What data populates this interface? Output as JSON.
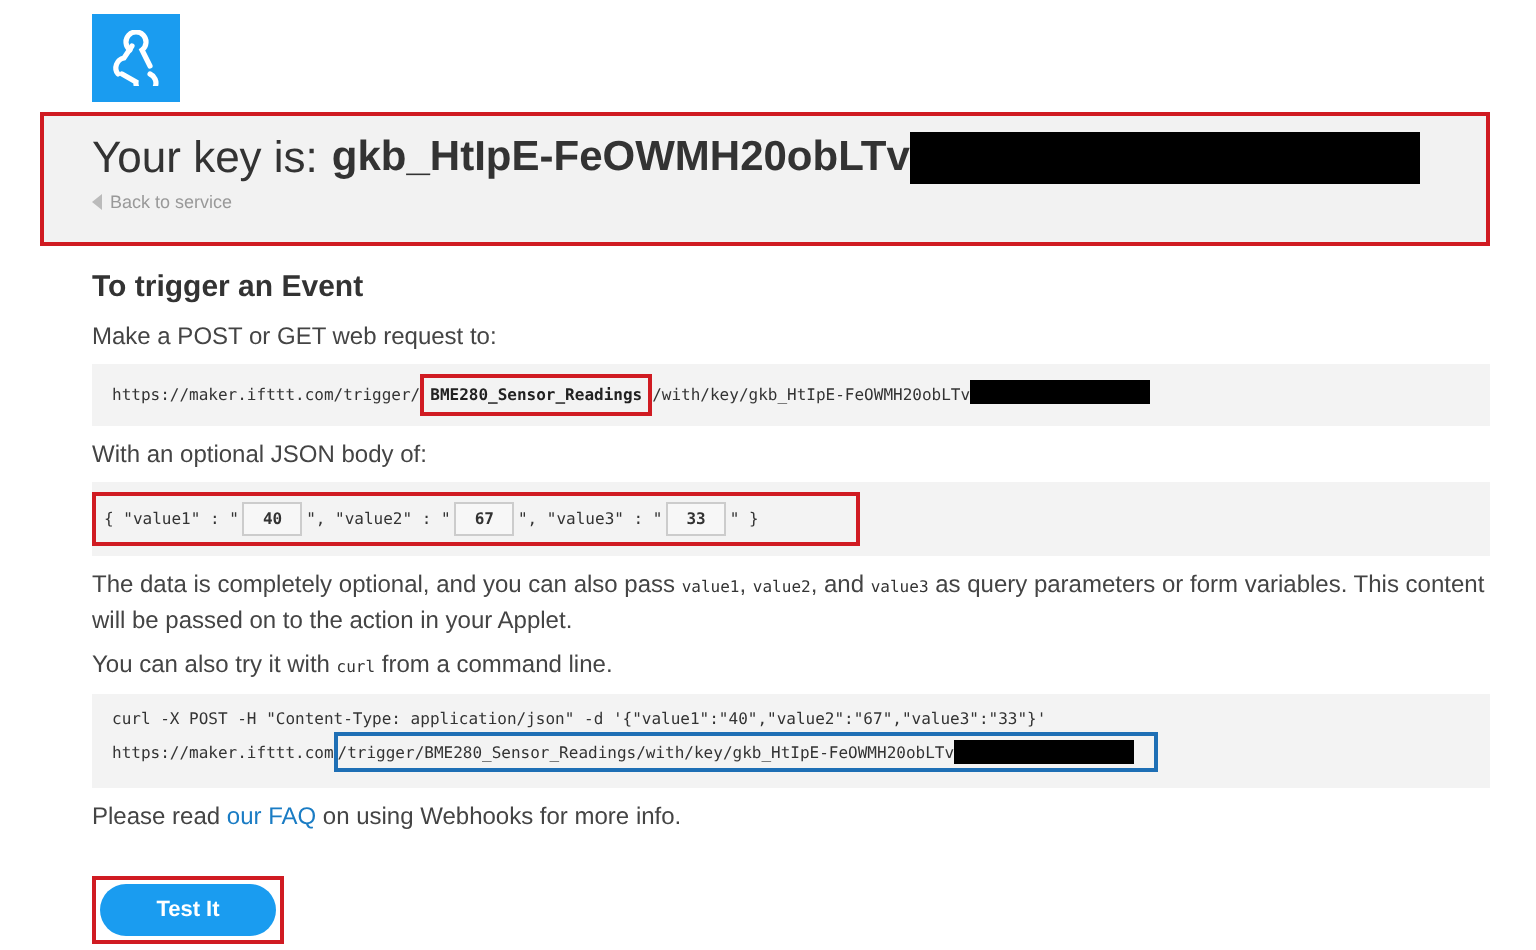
{
  "key_panel": {
    "label": "Your key is:",
    "key": "gkb_HtIpE-FeOWMH20obLTv",
    "back_link": "Back to service"
  },
  "heading": "To trigger an Event",
  "request_intro": "Make a POST or GET web request to:",
  "request_url": {
    "prefix": "https://maker.ifttt.com/trigger/",
    "event": "BME280_Sensor_Readings",
    "suffix": "/with/key/gkb_HtIpE-FeOWMH20obLTv"
  },
  "body_intro": "With an optional JSON body of:",
  "json_body": [
    {
      "kind": "code",
      "text": "{ \"value1\" : \""
    },
    {
      "kind": "input",
      "text": "40"
    },
    {
      "kind": "code",
      "text": "\", \"value2\" : \""
    },
    {
      "kind": "input",
      "text": "67"
    },
    {
      "kind": "code",
      "text": "\", \"value3\" : \""
    },
    {
      "kind": "input",
      "text": "33"
    },
    {
      "kind": "code",
      "text": "\" }"
    }
  ],
  "optional_note": [
    {
      "kind": "text",
      "text": "The data is completely optional, and you can also pass "
    },
    {
      "kind": "code",
      "text": "value1"
    },
    {
      "kind": "text",
      "text": ", "
    },
    {
      "kind": "code",
      "text": "value2"
    },
    {
      "kind": "text",
      "text": ", and "
    },
    {
      "kind": "code",
      "text": "value3"
    },
    {
      "kind": "text",
      "text": " as query parameters or form variables. This content will be passed on to the action in your Applet."
    }
  ],
  "curl_intro": [
    {
      "kind": "text",
      "text": "You can also try it with "
    },
    {
      "kind": "code",
      "text": "curl"
    },
    {
      "kind": "text",
      "text": " from a command line."
    }
  ],
  "curl_command": {
    "line1": "curl -X POST -H \"Content-Type: application/json\" -d '{\"value1\":\"40\",\"value2\":\"67\",\"value3\":\"33\"}'",
    "line2_start": "https://maker.ifttt.com",
    "line2_rest": "/trigger/BME280_Sensor_Readings/with/key/gkb_HtIpE-FeOWMH20obLTv"
  },
  "faq": {
    "before": "Please read ",
    "link": "our FAQ",
    "after": " on using Webhooks for more info."
  },
  "test_button": "Test It"
}
